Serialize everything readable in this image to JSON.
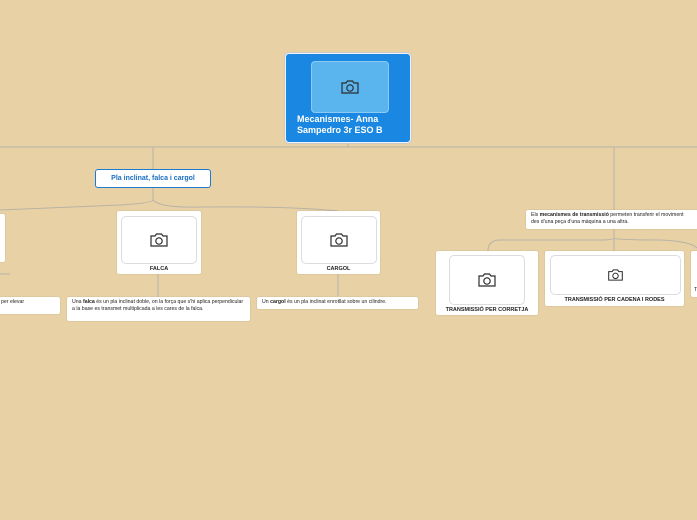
{
  "root": {
    "title": "Mecanismes- Anna Sampedro 3r ESO B",
    "image_icon": "camera-icon"
  },
  "topic": {
    "label": "Pla inclinat, falca i cargol"
  },
  "cards": {
    "falca": {
      "caption": "FALCA",
      "image_icon": "camera-icon"
    },
    "cargol": {
      "caption": "CARGOL",
      "image_icon": "camera-icon"
    },
    "corretja": {
      "caption": "TRANSMISSIÓ PER CORRETJA",
      "image_icon": "camera-icon"
    },
    "cadena": {
      "caption": "TRANSMISSIÓ PER CADENA I RODES",
      "image_icon": "camera-icon"
    }
  },
  "notes": {
    "left_partial": "per elevar",
    "falca": {
      "pre": "Una ",
      "bold": "falca",
      "post": " és un pla inclinat doble, on la força que s'hi aplica perpendicular a la base es transmet multiplicada a les cares de la falca."
    },
    "cargol": {
      "pre": "Un ",
      "bold": "cargol",
      "post": " és un pla inclinat enrotllat sobre un cilindre."
    },
    "transmissio": {
      "pre": "Els ",
      "bold": "mecanismes de transmissió",
      "post": " permeten transferir el moviment des d'una peça d'una màquina a una altra."
    },
    "right_partial": "T"
  },
  "colors": {
    "background": "#e8d1a5",
    "root": "#1a88e2",
    "topic_border": "#1a7bd0",
    "connector": "#bfb5a0"
  }
}
